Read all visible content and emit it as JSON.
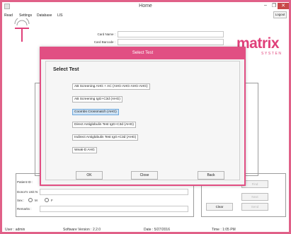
{
  "window": {
    "title": "Home",
    "controls": {
      "minimize": "–",
      "maximize": "❐",
      "close": "✕"
    }
  },
  "menu": {
    "items": [
      "Read",
      "Settings",
      "Database",
      "LIS"
    ],
    "logout_label": "Logout"
  },
  "form": {
    "card_name_label": "Card Name :",
    "card_barcode_label": "Card Barcode :",
    "patient_id_label": "Patient ID :",
    "donor_unit_label": "Donor's Unit N",
    "sex_label": "Sex :",
    "sex_options": [
      "M",
      "F"
    ],
    "remarks_label": "Remarks :"
  },
  "brand": {
    "name": "matrix",
    "subtitle": "SYSTEN",
    "color": "#e0407a"
  },
  "side_buttons": {
    "find": "Find",
    "next": "Next",
    "clear": "Clear",
    "send": "Send"
  },
  "status": {
    "user": "User :  admin",
    "software_version": "Software Version :  2.2.0",
    "date": "Date :  5/27/2016",
    "time": "Time :  1:05 PM"
  },
  "dialog": {
    "title": "Select Test",
    "heading": "Select Test",
    "accent": "#e14f83",
    "options": [
      {
        "label": "AB Screening AHG + AC  (AHG-AHG-AHG-AHG)",
        "selected": false
      },
      {
        "label": "AB Screening IgG+C3d (AHG)",
        "selected": false
      },
      {
        "label": "Coombs Crossmatch (AHG)",
        "selected": true
      },
      {
        "label": "Direct Antiglobulin Test IgG+C3d (AHG)",
        "selected": false
      },
      {
        "label": "Indirect Antiglobulin Test IgG+C3d (AHG)",
        "selected": false
      },
      {
        "label": "Weak-D AHG",
        "selected": false
      }
    ],
    "buttons": {
      "ok": "OK",
      "close": "Close",
      "back": "Back"
    }
  }
}
